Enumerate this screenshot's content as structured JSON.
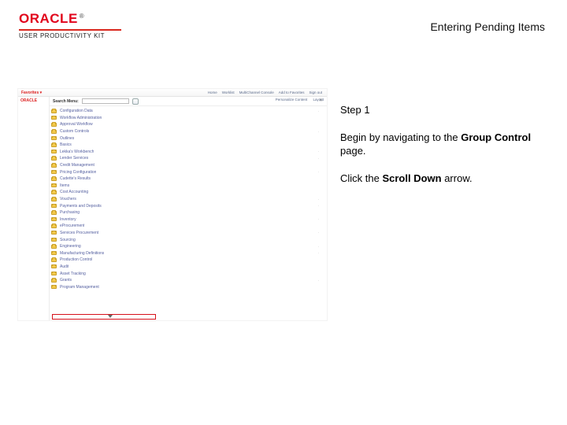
{
  "header": {
    "brand_word": "ORACLE",
    "brand_reg": "®",
    "upk_line": "USER PRODUCTIVITY KIT",
    "page_title": "Entering Pending Items"
  },
  "instructions": {
    "step_label": "Step 1",
    "line1_pre": "Begin by navigating to the ",
    "line1_bold": "Group Control",
    "line1_post": " page.",
    "line2_pre": "Click the ",
    "line2_bold": "Scroll Down",
    "line2_post": " arrow."
  },
  "screenshot": {
    "corp_label": "Favorites ▾",
    "mini_brand": "ORACLE",
    "top_nav": [
      "Home",
      "Worklist",
      "MultiChannel Console",
      "Add to Favorites",
      "Sign out"
    ],
    "right_bar": {
      "pc": "Personalize Content",
      "layout": "Layout"
    },
    "search": {
      "label": "Search Menu:",
      "close_glyph": "✕",
      "go_icon": "search-icon"
    },
    "nav_items": [
      {
        "label": "Configuration Data",
        "expand": true
      },
      {
        "label": "Workflow Administration",
        "expand": false
      },
      {
        "label": "Approval Workflow",
        "expand": false
      },
      {
        "label": "Custom Controls",
        "expand": true
      },
      {
        "label": "Outlines",
        "expand": false
      },
      {
        "label": "Basics",
        "expand": false
      },
      {
        "label": "Lekka's Workbench",
        "expand": true
      },
      {
        "label": "Lender Services",
        "expand": true
      },
      {
        "label": "Credit Management",
        "expand": false
      },
      {
        "label": "Pricing Configuration",
        "expand": true
      },
      {
        "label": "Cudette's Results",
        "expand": false
      },
      {
        "label": "Items",
        "expand": false
      },
      {
        "label": "Cost Accounting",
        "expand": false
      },
      {
        "label": "Vouchers",
        "expand": true
      },
      {
        "label": "Payments and Deposits",
        "expand": true
      },
      {
        "label": "Purchasing",
        "expand": false
      },
      {
        "label": "Inventory",
        "expand": true
      },
      {
        "label": "eProcurement",
        "expand": false
      },
      {
        "label": "Services Procurement",
        "expand": true
      },
      {
        "label": "Sourcing",
        "expand": false
      },
      {
        "label": "Engineering",
        "expand": true
      },
      {
        "label": "Manufacturing Definitions",
        "expand": true
      },
      {
        "label": "Production Control",
        "expand": false
      },
      {
        "label": "Audit",
        "expand": false
      },
      {
        "label": "Asset Tracking",
        "expand": false
      },
      {
        "label": "Grants",
        "expand": true
      },
      {
        "label": "Program Management",
        "expand": false
      }
    ]
  }
}
